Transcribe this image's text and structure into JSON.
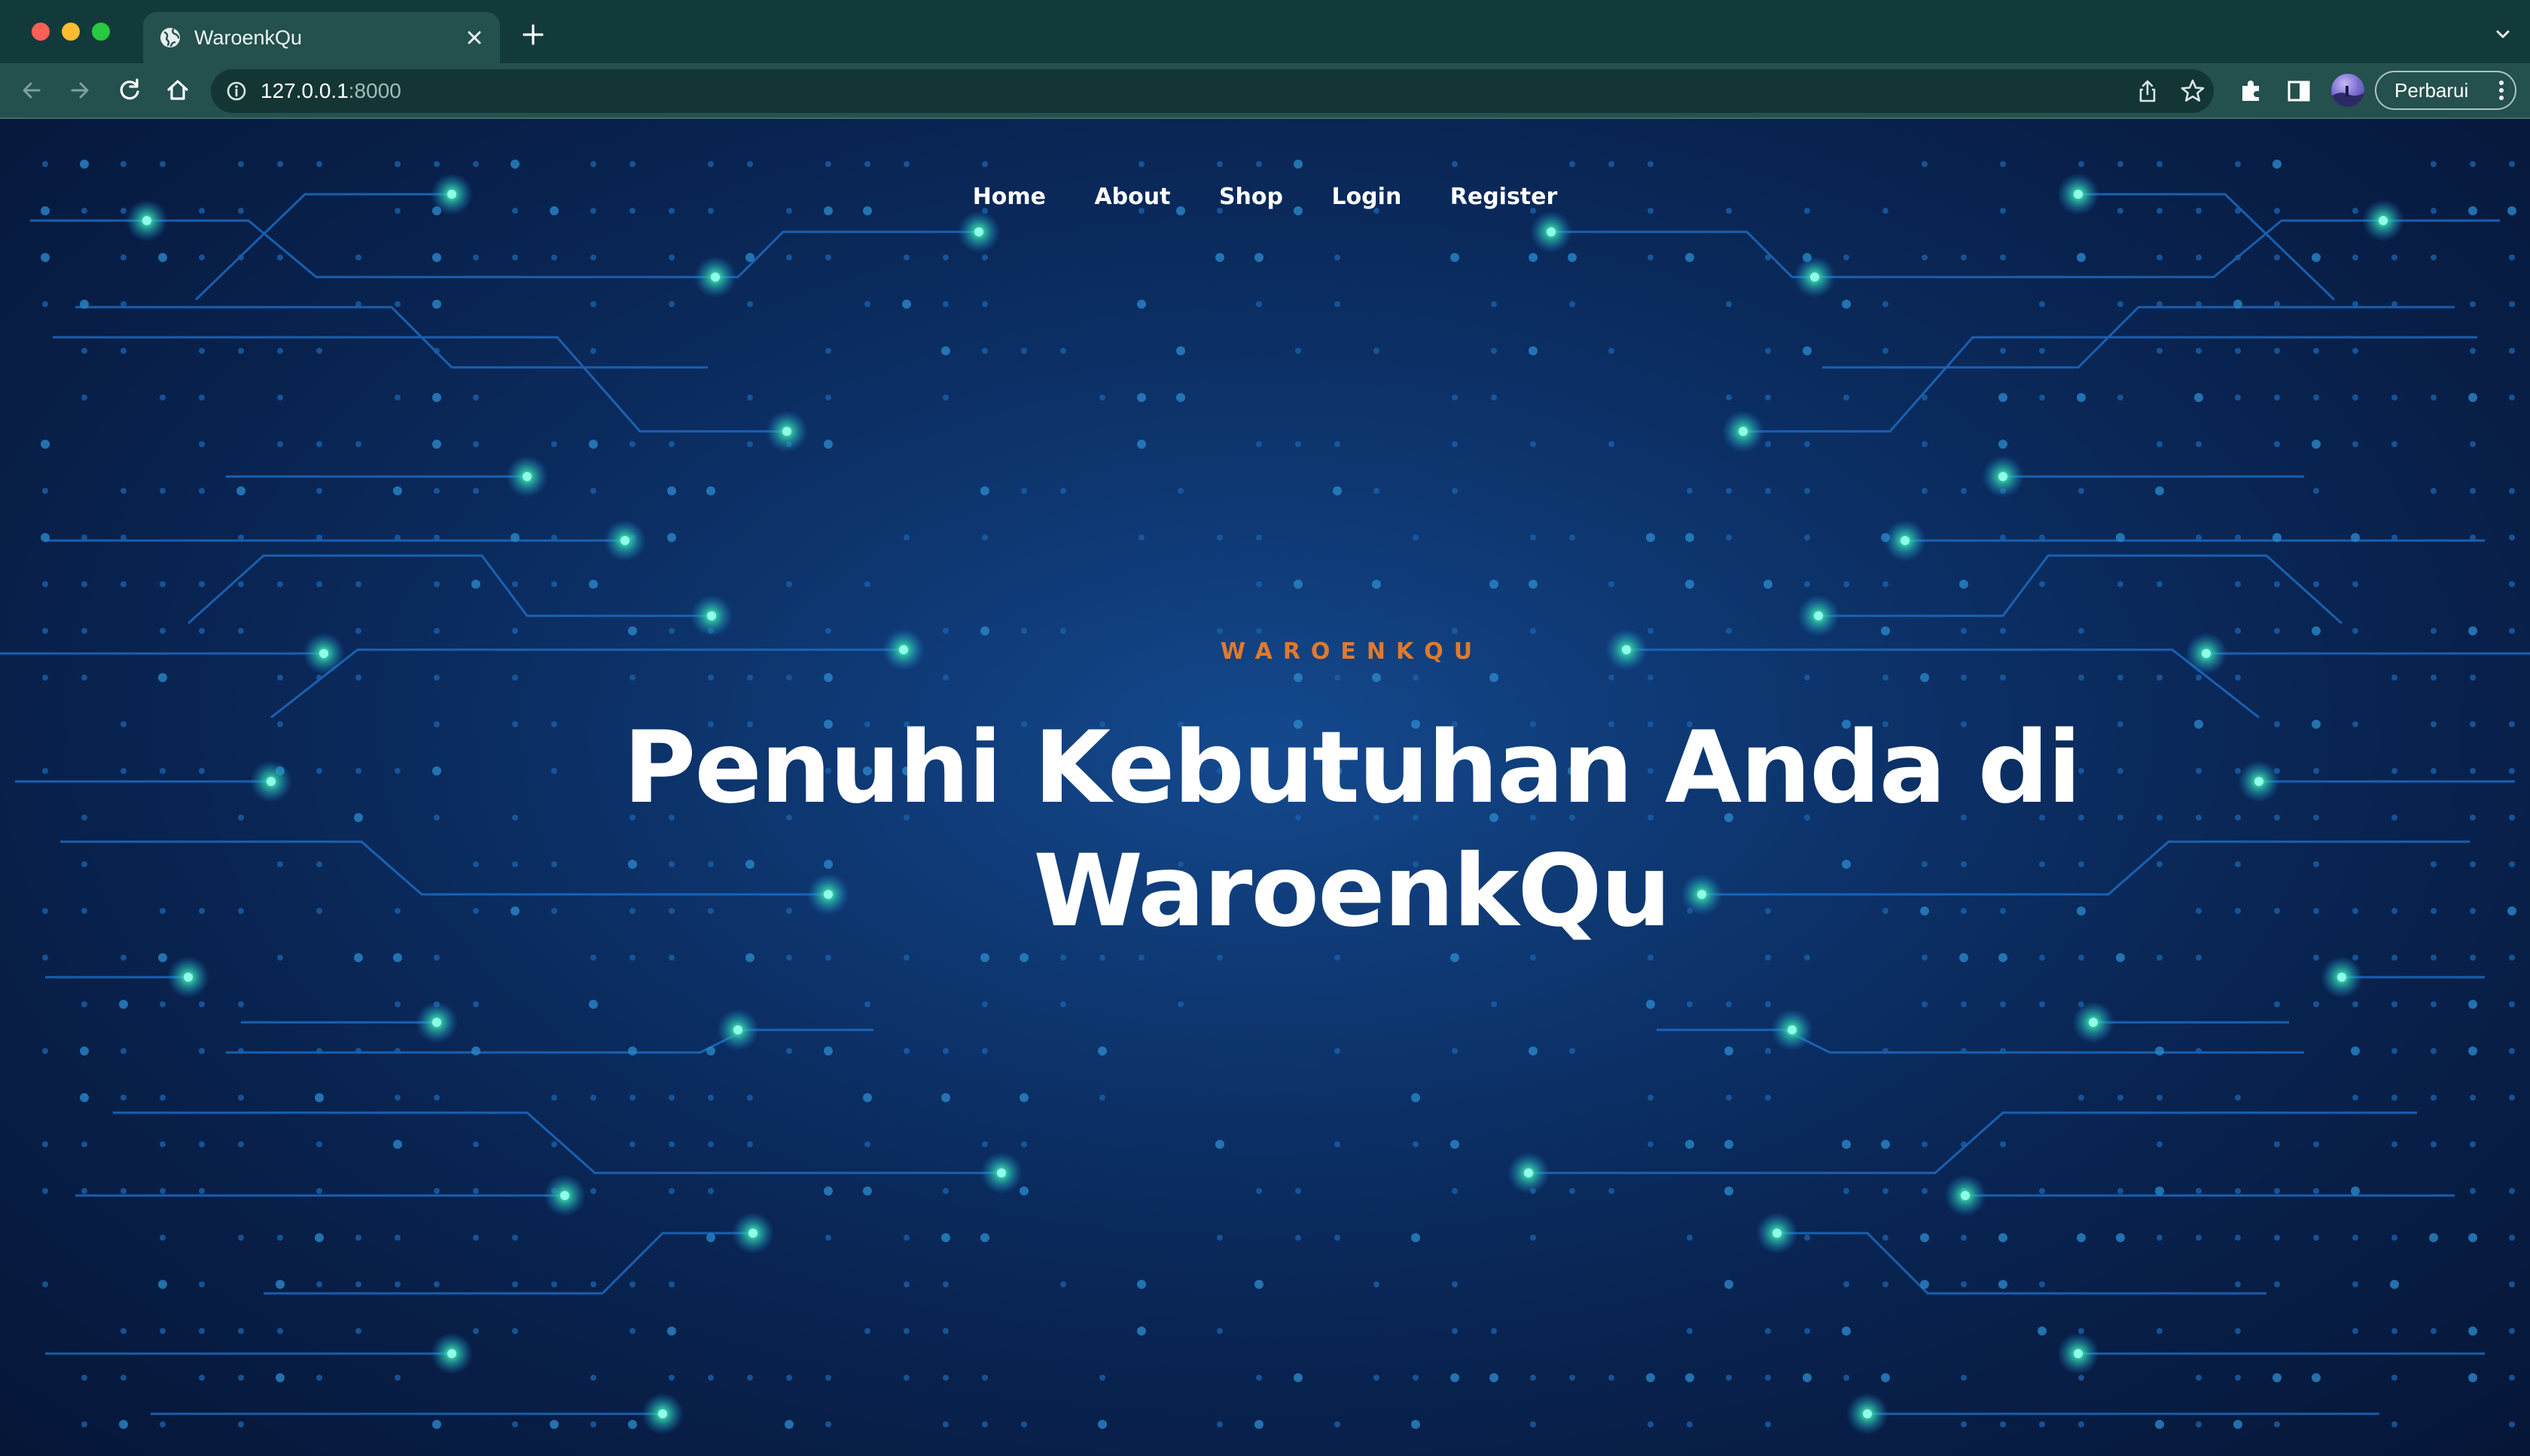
{
  "browser": {
    "tab_title": "WaroenkQu",
    "url_host": "127.0.0.1",
    "url_port": ":8000",
    "update_label": "Perbarui"
  },
  "nav": {
    "items": [
      "Home",
      "About",
      "Shop",
      "Login",
      "Register"
    ]
  },
  "hero": {
    "eyebrow": "WAROENKQU",
    "headline_line1": "Penuhi Kebutuhan Anda di",
    "headline_line2": "WaroenkQu"
  },
  "colors": {
    "accent": "#e07a2d",
    "page_bg": "#0b2e63",
    "chrome_bg": "#24504d",
    "circuit_glow": "#2ec8a8"
  },
  "icons": [
    "globe-icon",
    "close-icon",
    "plus-icon",
    "chevron-down-icon",
    "back-icon",
    "forward-icon",
    "reload-icon",
    "home-icon",
    "info-icon",
    "share-icon",
    "star-icon",
    "puzzle-icon",
    "side-panel-icon",
    "avatar",
    "more-vert-icon"
  ]
}
